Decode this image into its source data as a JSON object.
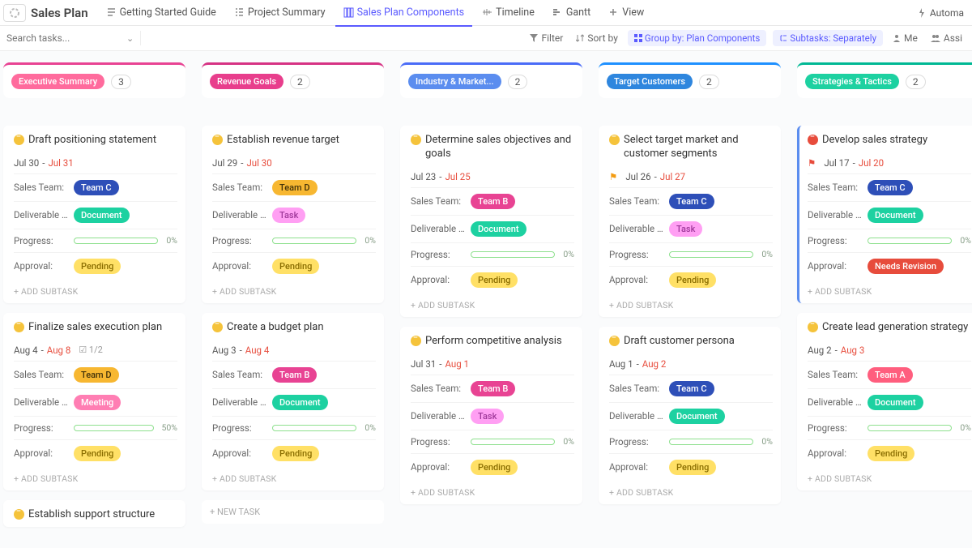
{
  "header": {
    "title": "Sales Plan",
    "tabs": [
      {
        "label": "Getting Started Guide",
        "active": false
      },
      {
        "label": "Project Summary",
        "active": false
      },
      {
        "label": "Sales Plan Components",
        "active": true
      },
      {
        "label": "Timeline",
        "active": false
      },
      {
        "label": "Gantt",
        "active": false
      },
      {
        "label": "View",
        "active": false,
        "plus": true
      }
    ],
    "automate": "Automa"
  },
  "toolbar": {
    "search_placeholder": "Search tasks...",
    "filter": "Filter",
    "sort": "Sort by",
    "group": "Group by: Plan Components",
    "subtasks": "Subtasks: Separately",
    "me": "Me",
    "assign": "Assi"
  },
  "labels": {
    "sales_team": "Sales Team:",
    "deliverable": "Deliverable ...",
    "progress": "Progress:",
    "approval": "Approval:",
    "add_subtask": "+ ADD SUBTASK",
    "new_task": "+ NEW TASK"
  },
  "columns": [
    {
      "name": "Executive Summary",
      "count": "3",
      "style": "col-pink",
      "cards": [
        {
          "title": "Draft positioning statement",
          "d1": "Jul 30",
          "d2": "Jul 31",
          "team": "Team C",
          "team_cls": "team-c",
          "deliv": "Document",
          "deliv_cls": "doc",
          "prog": 0,
          "pct": "0%",
          "approval": "Pending",
          "appr_cls": "pending"
        },
        {
          "title": "Finalize sales execution plan",
          "d1": "Aug 4",
          "d2": "Aug 8",
          "check": "1/2",
          "team": "Team D",
          "team_cls": "team-d",
          "deliv": "Meeting",
          "deliv_cls": "meeting",
          "prog": 50,
          "pct": "50%",
          "approval": "Pending",
          "appr_cls": "pending"
        },
        {
          "title": "Establish support structure",
          "no_body": true
        }
      ]
    },
    {
      "name": "Revenue Goals",
      "count": "2",
      "style": "col-magenta",
      "cards": [
        {
          "title": "Establish revenue target",
          "d1": "Jul 29",
          "d2": "Jul 30",
          "team": "Team D",
          "team_cls": "team-d",
          "deliv": "Task",
          "deliv_cls": "task",
          "prog": 0,
          "pct": "0%",
          "approval": "Pending",
          "appr_cls": "pending"
        },
        {
          "title": "Create a budget plan",
          "d1": "Aug 3",
          "d2": "Aug 4",
          "team": "Team B",
          "team_cls": "team-b",
          "deliv": "Document",
          "deliv_cls": "doc",
          "prog": 0,
          "pct": "0%",
          "approval": "Pending",
          "appr_cls": "pending"
        }
      ],
      "new_task": true
    },
    {
      "name": "Industry & Market...",
      "count": "2",
      "style": "col-blue",
      "cards": [
        {
          "title": "Determine sales objectives and goals",
          "d1": "Jul 23",
          "d2": "Jul 25",
          "team": "Team B",
          "team_cls": "team-b",
          "deliv": "Document",
          "deliv_cls": "doc",
          "prog": 0,
          "pct": "0%",
          "approval": "Pending",
          "appr_cls": "pending"
        },
        {
          "title": "Perform competitive analysis",
          "d1": "Jul 31",
          "d2": "Aug 1",
          "team": "Team B",
          "team_cls": "team-b",
          "deliv": "Task",
          "deliv_cls": "task",
          "prog": 0,
          "pct": "0%",
          "approval": "Pending",
          "appr_cls": "pending"
        }
      ]
    },
    {
      "name": "Target Customers",
      "count": "2",
      "style": "col-bblue",
      "cards": [
        {
          "title": "Select target market and customer segments",
          "d1": "Jul 26",
          "d2": "Jul 27",
          "flag": "yellow",
          "team": "Team C",
          "team_cls": "team-c",
          "deliv": "Task",
          "deliv_cls": "task",
          "prog": 0,
          "pct": "0%",
          "approval": "Pending",
          "appr_cls": "pending"
        },
        {
          "title": "Draft customer persona",
          "d1": "Aug 1",
          "d2": "Aug 2",
          "team": "Team C",
          "team_cls": "team-c",
          "deliv": "Document",
          "deliv_cls": "doc",
          "prog": 0,
          "pct": "0%",
          "approval": "Pending",
          "appr_cls": "pending"
        }
      ]
    },
    {
      "name": "Strategies & Tactics",
      "count": "2",
      "style": "col-green",
      "cards": [
        {
          "title": "Develop sales strategy",
          "d1": "Jul 17",
          "d2": "Jul 20",
          "flag": "red",
          "dot": "red",
          "accent": "blue",
          "team": "Team C",
          "team_cls": "team-c",
          "deliv": "Document",
          "deliv_cls": "doc",
          "prog": 0,
          "pct": "0%",
          "approval": "Needs Revision",
          "appr_cls": "revision"
        },
        {
          "title": "Create lead generation strategy",
          "d1": "Aug 2",
          "d2": "Aug 3",
          "team": "Team A",
          "team_cls": "team-a",
          "deliv": "Document",
          "deliv_cls": "doc",
          "prog": 0,
          "pct": "0%",
          "approval": "Pending",
          "appr_cls": "pending"
        }
      ]
    }
  ]
}
